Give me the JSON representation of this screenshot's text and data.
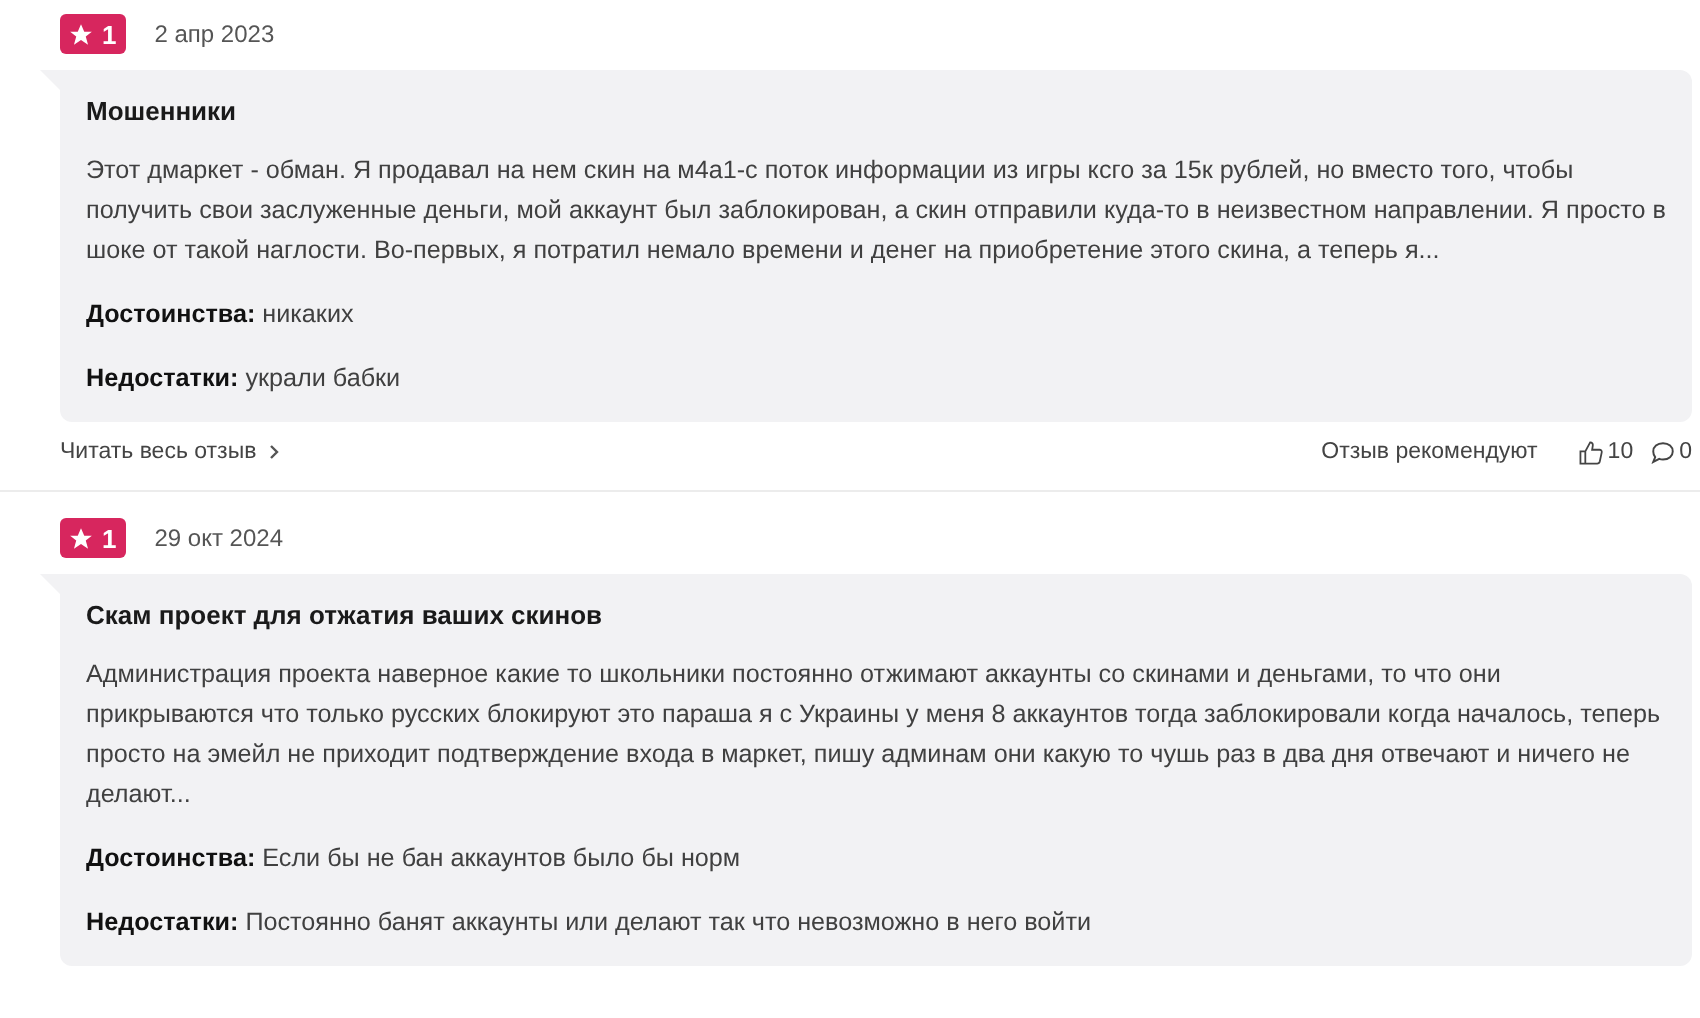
{
  "reviews": [
    {
      "rating": "1",
      "date": "2 апр 2023",
      "title": "Мошенники",
      "text": "Этот дмаркет - обман. Я продавал на нем скин на м4а1-с поток информации из игры ксго за 15к рублей, но вместо того, чтобы получить свои заслуженные деньги, мой аккаунт был заблокирован, а скин отправили куда-то в неизвестном направлении. Я просто в шоке от такой наглости. Во-первых, я потратил немало времени и денег на приобретение этого скина, а теперь я...",
      "pros": "**Достоинства:** никаких",
      "cons": "**Недостатки:** украли бабки",
      "footer": {
        "read_more": "Читать весь отзыв",
        "recommend": "Отзыв рекомендуют",
        "likes": "10",
        "comments": "0"
      }
    },
    {
      "rating": "1",
      "date": "29 окт 2024",
      "title": "Скам проект для отжатия ваших скинов",
      "text": "Администрация проекта наверное какие то школьники постоянно отжимают аккаунты со скинами и деньгами, то что они прикрываются что только русских блокируют это параша я с Украины у меня 8 аккаунтов тогда заблокировали когда началось, теперь просто на эмейл не приходит подтверждение входа в маркет, пишу админам они какую то чушь раз в два дня отвечают и ничего не делают...",
      "pros": "**Достоинства:** Если бы не бан аккаунтов было бы норм",
      "cons": "**Недостатки:** Постоянно банят аккаунты или делают так что невозможно в него войти"
    }
  ]
}
